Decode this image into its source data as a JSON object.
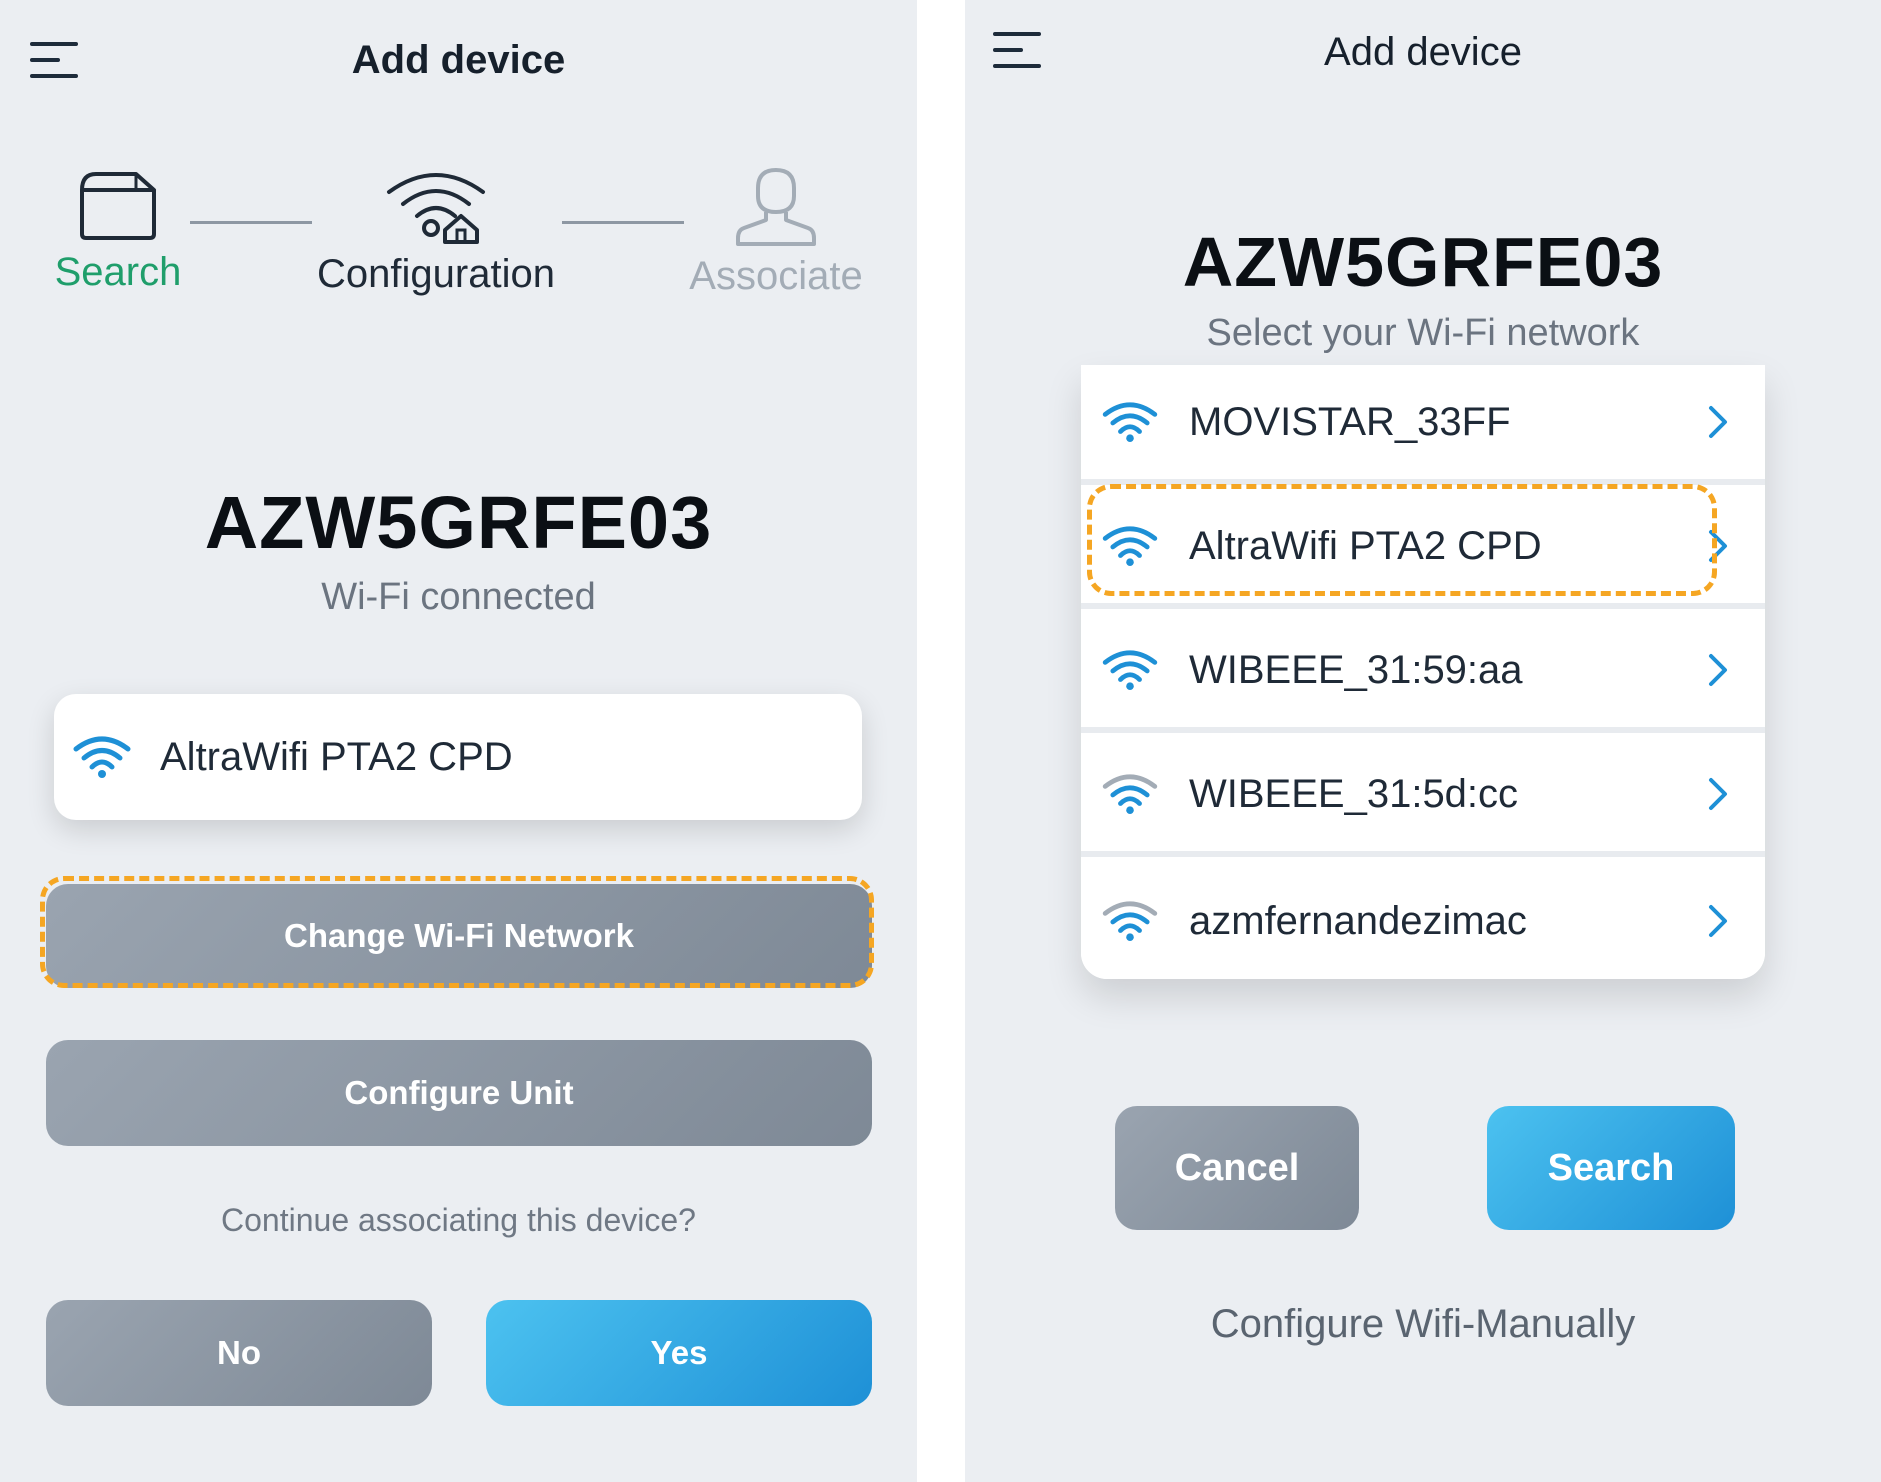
{
  "left": {
    "title": "Add device",
    "steps": [
      {
        "label": "Search",
        "icon": "box-icon",
        "color": "#1f9e6b"
      },
      {
        "label": "Configuration",
        "icon": "wifi-home-icon",
        "color": "#1f2a37"
      },
      {
        "label": "Associate",
        "icon": "person-icon",
        "color": "#a3acb6"
      }
    ],
    "device_id": "AZW5GRFE03",
    "status": "Wi-Fi connected",
    "connected_network": "AltraWifi PTA2 CPD",
    "change_network_label": "Change Wi-Fi Network",
    "configure_unit_label": "Configure Unit",
    "question": "Continue associating this device?",
    "no_label": "No",
    "yes_label": "Yes"
  },
  "right": {
    "title": "Add device",
    "device_id": "AZW5GRFE03",
    "prompt": "Select your Wi-Fi network",
    "networks": [
      {
        "name": "MOVISTAR_33FF",
        "signal": "strong"
      },
      {
        "name": "AltraWifi PTA2 CPD",
        "signal": "strong"
      },
      {
        "name": "WIBEEE_31:59:aa",
        "signal": "strong"
      },
      {
        "name": "WIBEEE_31:5d:cc",
        "signal": "weak"
      },
      {
        "name": "azmfernandezimac",
        "signal": "weak"
      }
    ],
    "cancel_label": "Cancel",
    "search_label": "Search",
    "manual_label": "Configure Wifi-Manually"
  },
  "colors": {
    "accent_blue": "#1e90d6",
    "highlight": "#f5a623",
    "search_green": "#1f9e6b"
  }
}
